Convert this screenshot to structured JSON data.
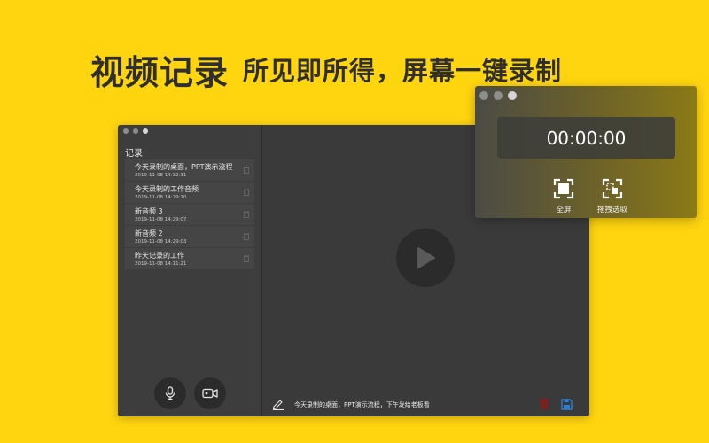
{
  "headline": {
    "main": "视频记录",
    "sub": "所见即所得，屏幕一键录制"
  },
  "sidebar": {
    "title": "记录",
    "records": [
      {
        "title": "今天录制的桌面，PPT演示流程",
        "time": "2019-11-08 14:32:31"
      },
      {
        "title": "今天录制的工作音频",
        "time": "2019-11-08 14:29:10"
      },
      {
        "title": "新音频 3",
        "time": "2019-11-08 14:29:07"
      },
      {
        "title": "新音频 2",
        "time": "2019-11-08 14:29:03"
      },
      {
        "title": "昨天记录的工作",
        "time": "2019-11-08 14:11:21"
      }
    ]
  },
  "editor": {
    "note": "今天录制的桌面，PPT演示流程，下午发给老板看"
  },
  "recorder": {
    "timer": "00:00:00",
    "modes": {
      "fullscreen": "全屏",
      "drag_select": "拖拽选取"
    }
  },
  "colors": {
    "background": "#FFD510",
    "window": "#3A3A3A",
    "delete": "#8B1A1A",
    "save": "#2D7FD3"
  },
  "icons": [
    "microphone-icon",
    "video-camera-icon",
    "play-icon",
    "pencil-icon",
    "trash-icon",
    "save-icon",
    "fullscreen-icon",
    "drag-select-icon",
    "trash-small-icon"
  ]
}
